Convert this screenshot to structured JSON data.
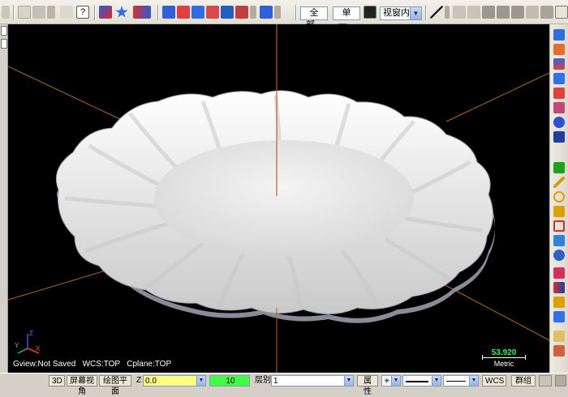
{
  "toolbar": {
    "btn_all_label": "全部...",
    "btn_single_label": "单一...",
    "view_select_value": "视窗内",
    "icons": [
      "undo-icon",
      "redo-icon",
      "help-icon",
      "snap-icon",
      "star-icon",
      "select-icon",
      "grid-icon",
      "wireframe-icon",
      "shade-icon",
      "render-icon"
    ]
  },
  "viewport": {
    "status_gview": "Gview:Not Saved",
    "status_wcs": "WCS:TOP",
    "status_cplane": "Cplane:TOP",
    "scale_value": "53.920",
    "scale_unit": "Metric",
    "axis_labels": {
      "x": "X",
      "y": "Y",
      "z": "Z"
    },
    "colors": {
      "background": "#000000",
      "axis_line": "#b06a1a",
      "model_surface": "#ffffff",
      "model_edge": "#7a7a8a"
    }
  },
  "statusbar": {
    "btn_3d": "3D",
    "btn_screen_view": "屏幕视角",
    "btn_plane": "绘图平面",
    "z_label": "Z",
    "z_value": "0.0",
    "level_value": "10",
    "layer_label": "层别",
    "layer_value": "1",
    "attr_label": "属性",
    "wcs_label": "WCS",
    "group_label": "群组"
  },
  "right_toolbar": {
    "icons": [
      "move-icon",
      "mirror-icon",
      "rotate-icon",
      "layer-icon",
      "color-icon",
      "analyze-icon",
      "save-icon",
      "add-icon",
      "line-icon",
      "arc-icon",
      "fillet-icon",
      "rect-icon",
      "solid-icon",
      "sphere-icon",
      "trim-icon",
      "break-icon",
      "offset-icon",
      "transform-icon",
      "dimension-icon",
      "note-icon"
    ]
  }
}
